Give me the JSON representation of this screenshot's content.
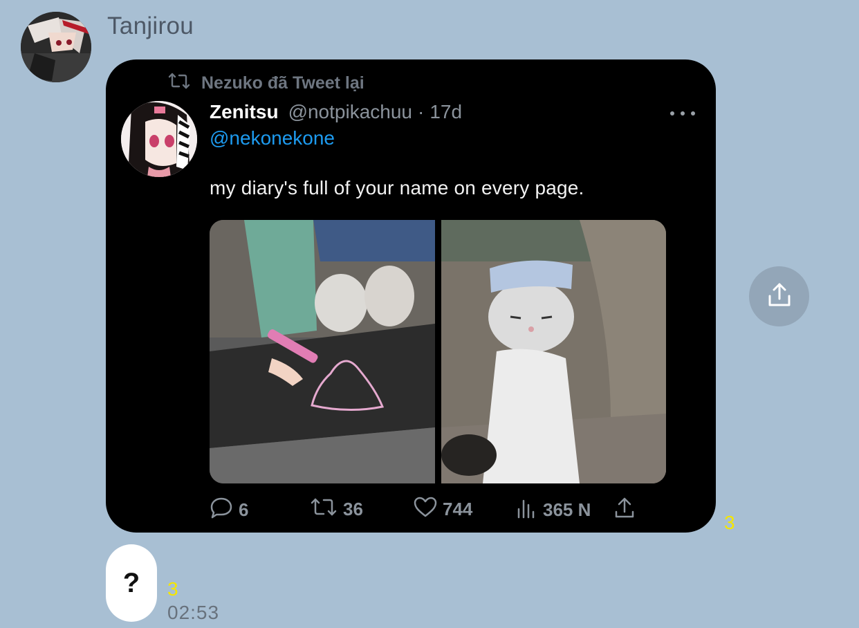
{
  "chat": {
    "sender_name": "Tanjirou",
    "read_count_1": "3",
    "read_count_2": "3",
    "timestamp": "02:53",
    "bubble_text": "?"
  },
  "tweet": {
    "retweet_label": "Nezuko đã Tweet lại",
    "author": "Zenitsu",
    "handle": "@notpikachuu",
    "separator": "·",
    "time": "17d",
    "mention": "@nekonekone",
    "text": "my diary's full of your name on every page.",
    "reply_count": "6",
    "retweet_count": "36",
    "like_count": "744",
    "view_count": "365 N"
  },
  "icons": {
    "retweet": "retweet-icon",
    "reply": "reply-icon",
    "like": "heart-icon",
    "views": "views-icon",
    "share": "share-icon",
    "more": "more-icon"
  },
  "colors": {
    "background": "#a8bfd3",
    "tweet_bg": "#000000",
    "mention": "#1d9bf0",
    "read_count": "#f5e600",
    "share_circle": "#93a6b8"
  }
}
